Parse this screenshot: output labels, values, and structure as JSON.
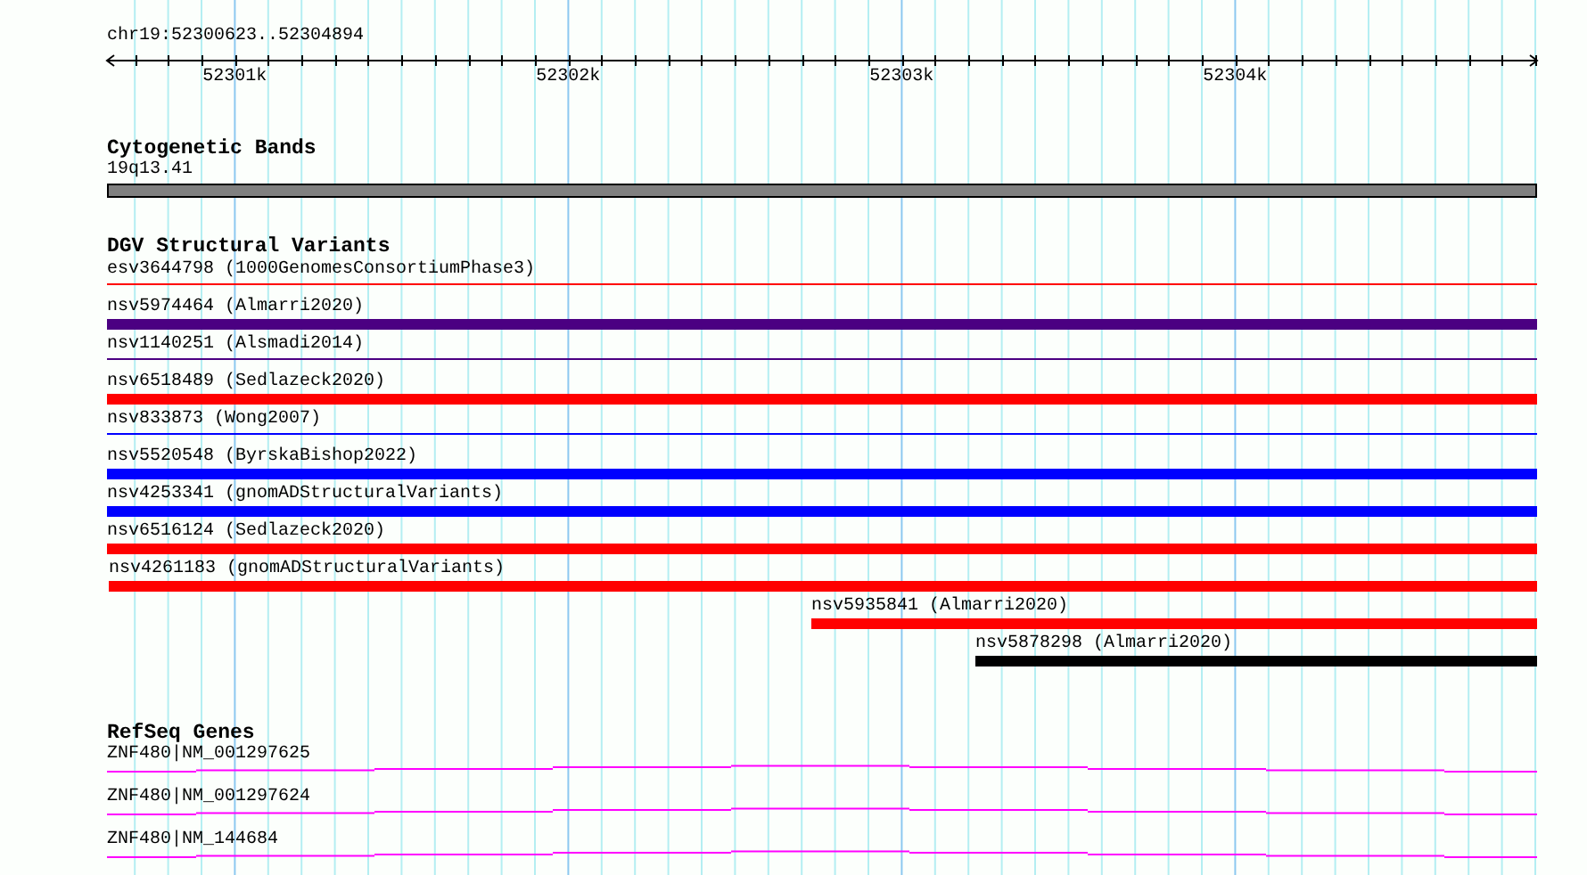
{
  "location": "chr19:52300623..52304894",
  "ruler": {
    "tick_labels": [
      "52301k",
      "52302k",
      "52303k",
      "52304k"
    ]
  },
  "cytoband": {
    "title": "Cytogenetic Bands",
    "label": "19q13.41"
  },
  "dgv": {
    "title": "DGV Structural Variants",
    "features": [
      {
        "label": "esv3644798 (1000GenomesConsortiumPhase3)",
        "kind": "thin",
        "color": "#ff0000"
      },
      {
        "label": "nsv5974464 (Almarri2020)",
        "kind": "thick",
        "color": "#4b0082"
      },
      {
        "label": "nsv1140251 (Alsmadi2014)",
        "kind": "thin",
        "color": "#4b0082"
      },
      {
        "label": "nsv6518489 (Sedlazeck2020)",
        "kind": "thick",
        "color": "#ff0000"
      },
      {
        "label": "nsv833873 (Wong2007)",
        "kind": "thin",
        "color": "#0000ff"
      },
      {
        "label": "nsv5520548 (ByrskaBishop2022)",
        "kind": "thick",
        "color": "#0000ff"
      },
      {
        "label": "nsv4253341 (gnomADStructuralVariants)",
        "kind": "thick",
        "color": "#0000ff"
      },
      {
        "label": "nsv6516124 (Sedlazeck2020)",
        "kind": "thick",
        "color": "#ff0000"
      },
      {
        "label": "nsv4261183 (gnomADStructuralVariants)",
        "kind": "thick",
        "color": "#ff0000"
      },
      {
        "label": "nsv5935841 (Almarri2020)",
        "kind": "thick",
        "color": "#ff0000"
      },
      {
        "label": "nsv5878298 (Almarri2020)",
        "kind": "thick",
        "color": "#000000"
      }
    ]
  },
  "refseq": {
    "title": "RefSeq Genes",
    "genes": [
      {
        "label": "ZNF480|NM_001297625"
      },
      {
        "label": "ZNF480|NM_001297624"
      },
      {
        "label": "ZNF480|NM_144684"
      }
    ]
  }
}
